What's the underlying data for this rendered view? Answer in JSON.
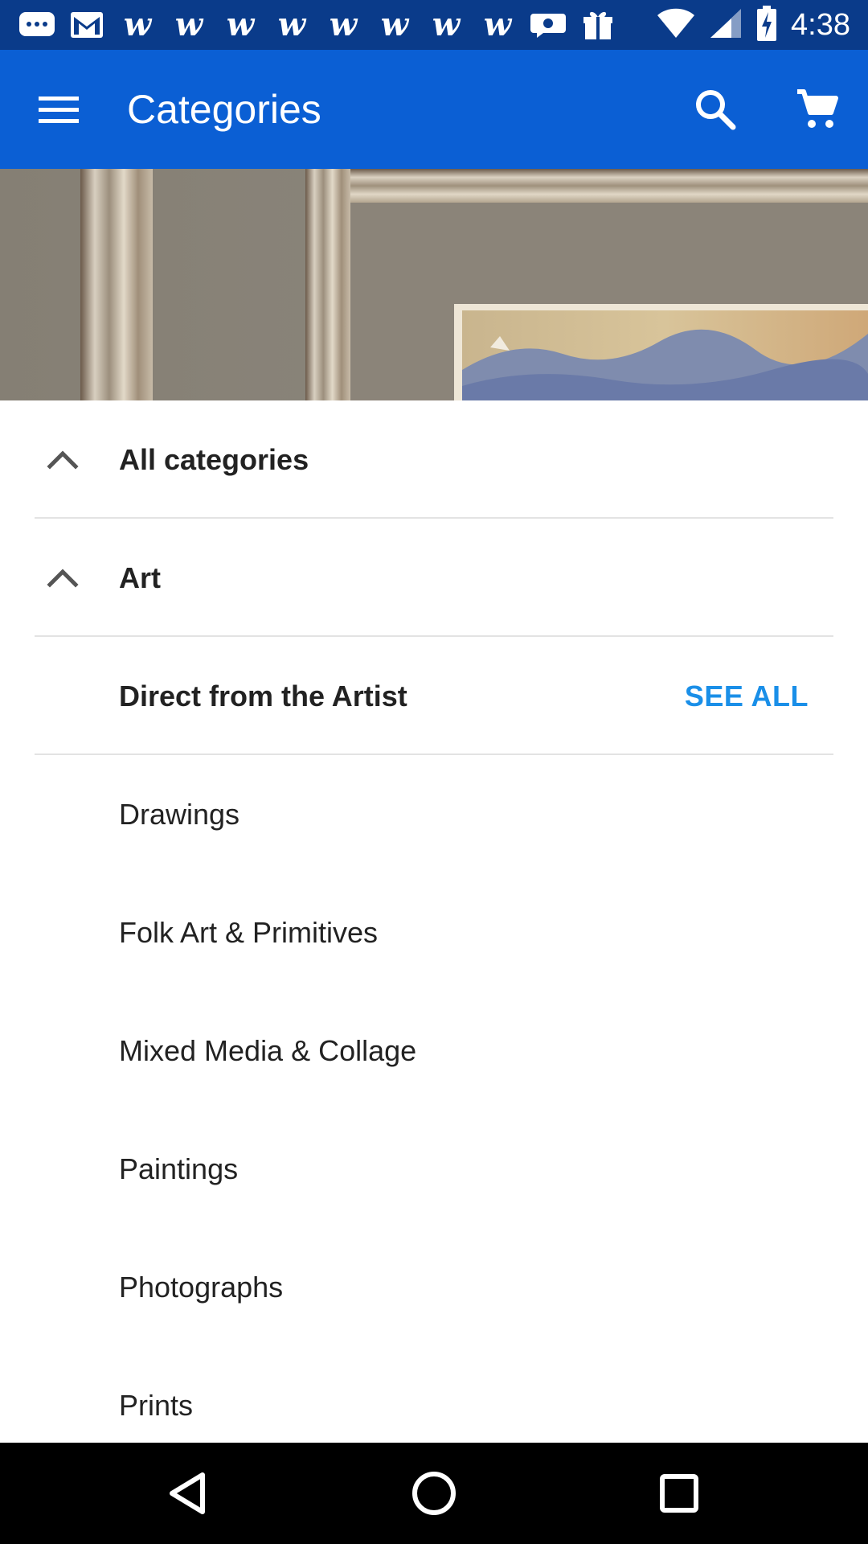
{
  "status_bar": {
    "time": "4:38",
    "notification_icons": [
      "chat-icon",
      "gmail-icon",
      "w-app-icon",
      "w-app-icon",
      "w-app-icon",
      "w-app-icon",
      "w-app-icon",
      "w-app-icon",
      "w-app-icon",
      "w-app-icon",
      "message-bubble-icon",
      "gift-box-icon"
    ],
    "w_glyph": "w",
    "system_icons": [
      "wifi-icon",
      "signal-icon",
      "battery-charging-icon"
    ]
  },
  "app_bar": {
    "title": "Categories",
    "menu_icon": "hamburger-menu-icon",
    "search_icon": "search-icon",
    "cart_icon": "shopping-cart-icon",
    "color": "#0b5fd4"
  },
  "list": {
    "all_categories": "All categories",
    "art": "Art",
    "direct_from_artist": "Direct from the Artist",
    "see_all": "SEE ALL",
    "items": [
      "Drawings",
      "Folk Art & Primitives",
      "Mixed Media & Collage",
      "Paintings",
      "Photographs",
      "Prints"
    ]
  },
  "nav_bar": {
    "back_icon": "back-triangle-icon",
    "home_icon": "home-circle-icon",
    "recents_icon": "recents-square-icon"
  },
  "colors": {
    "status_bar": "#0a3b8a",
    "accent_link": "#1a8fe8"
  }
}
